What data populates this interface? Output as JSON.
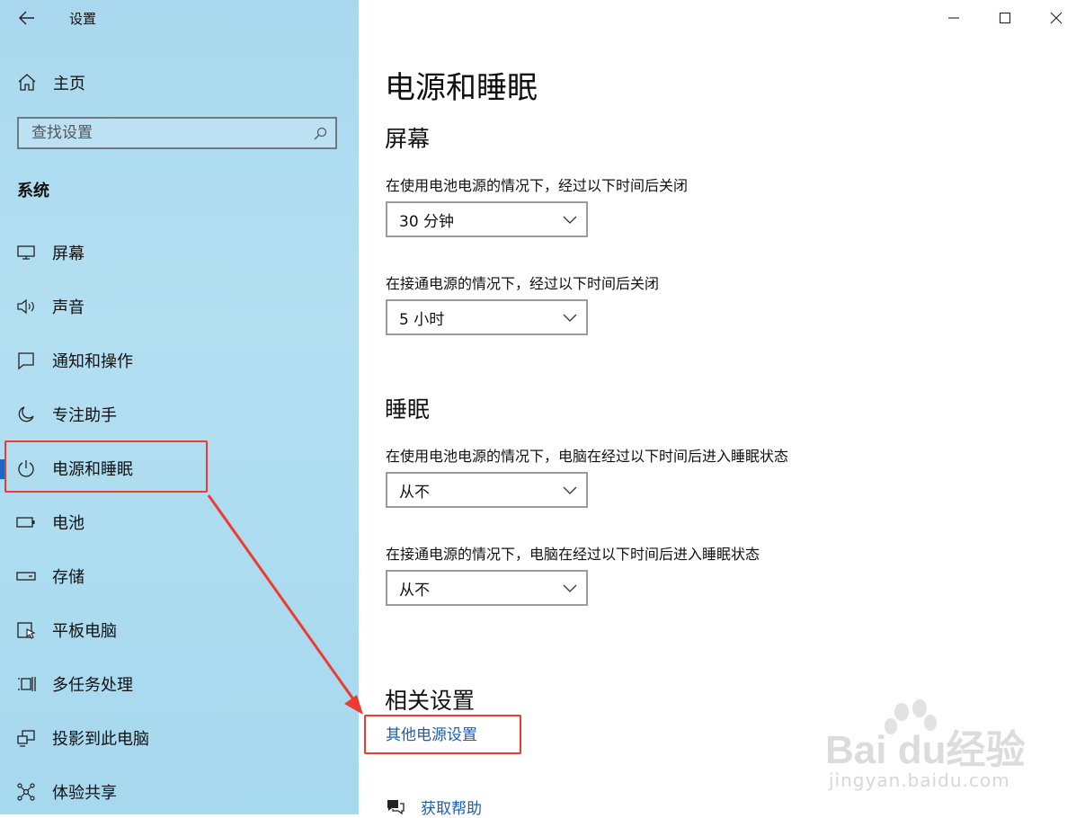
{
  "window": {
    "title": "设置"
  },
  "sidebar": {
    "home_label": "主页",
    "search_placeholder": "查找设置",
    "section_label": "系统",
    "items": [
      {
        "label": "屏幕",
        "icon": "monitor-icon"
      },
      {
        "label": "声音",
        "icon": "speaker-icon"
      },
      {
        "label": "通知和操作",
        "icon": "notification-icon"
      },
      {
        "label": "专注助手",
        "icon": "moon-icon"
      },
      {
        "label": "电源和睡眠",
        "icon": "power-icon",
        "selected": true
      },
      {
        "label": "电池",
        "icon": "battery-icon"
      },
      {
        "label": "存储",
        "icon": "storage-icon"
      },
      {
        "label": "平板电脑",
        "icon": "tablet-icon"
      },
      {
        "label": "多任务处理",
        "icon": "multitask-icon"
      },
      {
        "label": "投影到此电脑",
        "icon": "project-icon"
      },
      {
        "label": "体验共享",
        "icon": "share-icon"
      }
    ]
  },
  "main": {
    "title": "电源和睡眠",
    "screen": {
      "heading": "屏幕",
      "battery_label": "在使用电池电源的情况下，经过以下时间后关闭",
      "battery_value": "30 分钟",
      "plugged_label": "在接通电源的情况下，经过以下时间后关闭",
      "plugged_value": "5 小时"
    },
    "sleep": {
      "heading": "睡眠",
      "battery_label": "在使用电池电源的情况下，电脑在经过以下时间后进入睡眠状态",
      "battery_value": "从不",
      "plugged_label": "在接通电源的情况下，电脑在经过以下时间后进入睡眠状态",
      "plugged_value": "从不"
    },
    "related": {
      "heading": "相关设置",
      "link": "其他电源设置"
    },
    "help_label": "获取帮助"
  },
  "watermark": {
    "brand": "Bai du经验",
    "url": "jingyan.baidu.com"
  },
  "colors": {
    "sidebar_bg": "#a9d8ee",
    "accent": "#1a66c4",
    "link": "#1a5fb4",
    "annotation": "#ee3b2f"
  }
}
